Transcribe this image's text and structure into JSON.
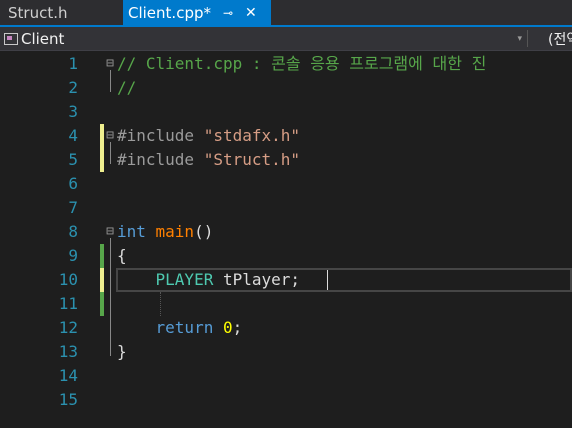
{
  "tabs": [
    {
      "label": "Struct.h"
    },
    {
      "label": "Client.cpp*",
      "pin_icon": "pin-icon",
      "close_glyph": "✕"
    }
  ],
  "navbar": {
    "project": "Client",
    "scope": "(전역"
  },
  "colors": {
    "accent": "#007acc",
    "line_number": "#2b91af",
    "comment": "#57a64a",
    "keyword": "#569cd6",
    "string": "#d69d85",
    "function": "#ff8000",
    "type": "#4ec9b0",
    "change_unsaved": "#efef8f",
    "change_saved": "#57a64a"
  },
  "code_lines": [
    {
      "n": "1",
      "fold": "⊟",
      "change": "",
      "parts": [
        {
          "t": "// Client.cpp : 콘솔 응용 프로그램에 대한 진",
          "c": "c-comment"
        }
      ]
    },
    {
      "n": "2",
      "fold": "",
      "change": "",
      "parts": [
        {
          "t": "//",
          "c": "c-comment"
        }
      ]
    },
    {
      "n": "3",
      "fold": "",
      "change": "",
      "parts": []
    },
    {
      "n": "4",
      "fold": "⊟",
      "change": "yellow",
      "parts": [
        {
          "t": "#include ",
          "c": "c-preproc"
        },
        {
          "t": "\"stdafx.h\"",
          "c": "c-string"
        }
      ]
    },
    {
      "n": "5",
      "fold": "",
      "change": "yellow",
      "parts": [
        {
          "t": "#include ",
          "c": "c-preproc"
        },
        {
          "t": "\"Struct.h\"",
          "c": "c-string"
        }
      ]
    },
    {
      "n": "6",
      "fold": "",
      "change": "",
      "parts": []
    },
    {
      "n": "7",
      "fold": "",
      "change": "",
      "parts": []
    },
    {
      "n": "8",
      "fold": "⊟",
      "change": "",
      "parts": [
        {
          "t": "int ",
          "c": "c-keyword"
        },
        {
          "t": "main",
          "c": "c-func"
        },
        {
          "t": "()",
          "c": ""
        }
      ]
    },
    {
      "n": "9",
      "fold": "",
      "change": "green",
      "parts": [
        {
          "t": "{",
          "c": ""
        }
      ]
    },
    {
      "n": "10",
      "fold": "",
      "change": "yellow",
      "parts": [
        {
          "t": "    ",
          "c": ""
        },
        {
          "t": "PLAYER",
          "c": "c-type"
        },
        {
          "t": " tPlayer;",
          "c": ""
        }
      ]
    },
    {
      "n": "11",
      "fold": "",
      "change": "green",
      "parts": []
    },
    {
      "n": "12",
      "fold": "",
      "change": "",
      "parts": [
        {
          "t": "    ",
          "c": ""
        },
        {
          "t": "return ",
          "c": "c-keyword"
        },
        {
          "t": "0",
          "c": "c-number"
        },
        {
          "t": ";",
          "c": ""
        }
      ]
    },
    {
      "n": "13",
      "fold": "",
      "change": "",
      "parts": [
        {
          "t": "}",
          "c": ""
        }
      ]
    },
    {
      "n": "14",
      "fold": "",
      "change": "",
      "parts": []
    },
    {
      "n": "15",
      "fold": "",
      "change": "",
      "parts": []
    }
  ]
}
